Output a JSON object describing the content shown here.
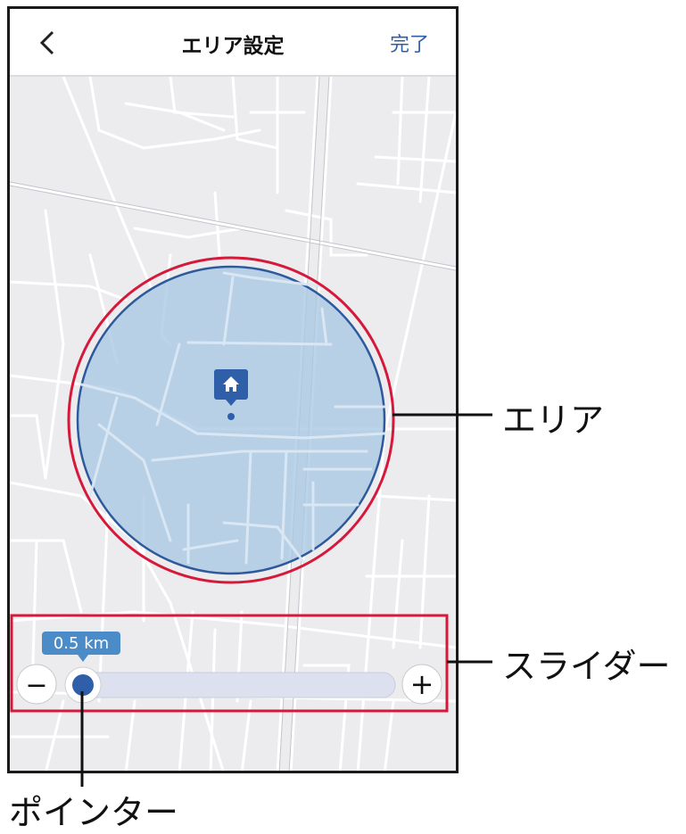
{
  "header": {
    "title": "エリア設定",
    "done_label": "完了"
  },
  "slider": {
    "value_label": "0.5 km",
    "value_fraction": 0.03,
    "minus_label": "−",
    "plus_label": "+"
  },
  "callouts": {
    "area": "エリア",
    "slider": "スライダー",
    "pointer": "ポインター"
  },
  "colors": {
    "accent_blue": "#2f5fa8",
    "highlight_red": "#d6183a",
    "area_fill": "#a9c8e3",
    "map_bg": "#ececee"
  },
  "icons": {
    "back": "chevron-left-icon",
    "home_pin": "home-pin-icon"
  }
}
